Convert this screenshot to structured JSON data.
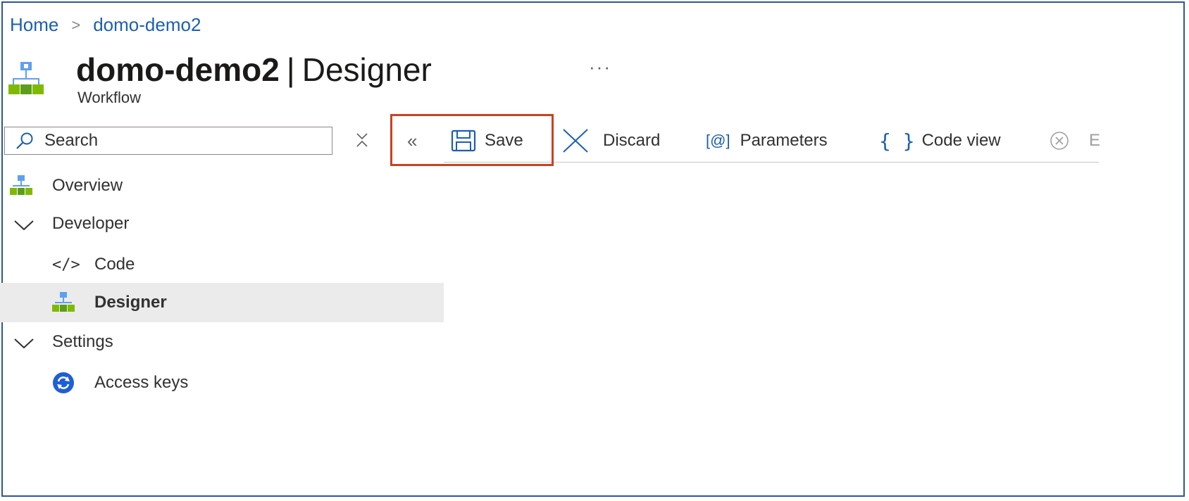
{
  "breadcrumb": {
    "home": "Home",
    "separator": ">",
    "current": "domo-demo2"
  },
  "header": {
    "name": "domo-demo2",
    "separator": "|",
    "page": "Designer",
    "more": "···",
    "subtitle": "Workflow"
  },
  "search": {
    "placeholder": "Search"
  },
  "toolbar": {
    "collapse": "«",
    "save": "Save",
    "discard": "Discard",
    "parameters_icon": "[@]",
    "parameters": "Parameters",
    "codeview_icon": "{ }",
    "codeview": "Code view",
    "truncated": "E"
  },
  "nav": {
    "overview": "Overview",
    "developer": "Developer",
    "code": "Code",
    "code_icon": "</>",
    "designer": "Designer",
    "settings": "Settings",
    "access_keys": "Access keys"
  },
  "colors": {
    "accent": "#1a5fb4",
    "highlight": "#c9421f",
    "selected_bg": "#ebebeb"
  }
}
